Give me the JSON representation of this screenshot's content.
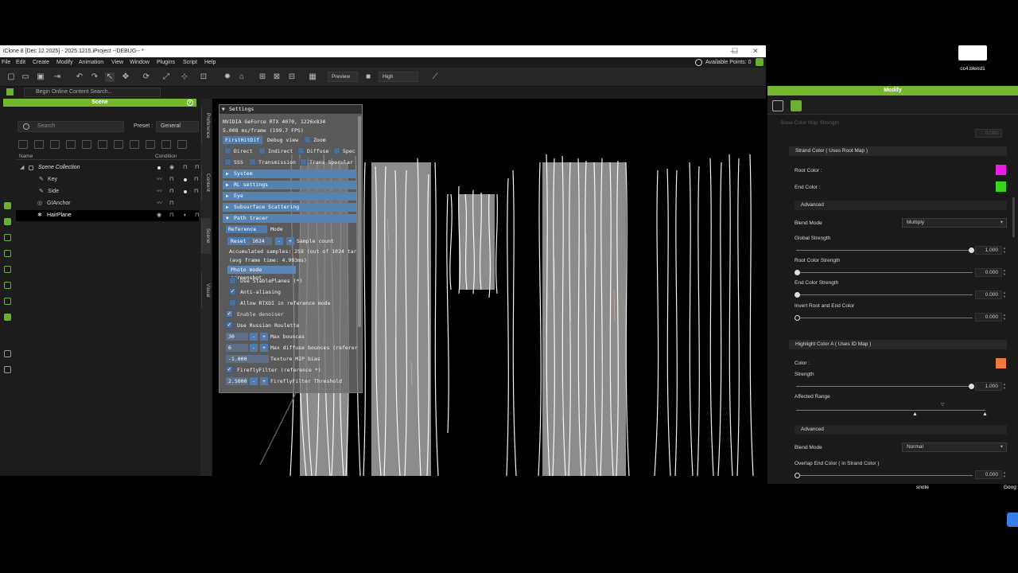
{
  "window": {
    "title": "iClone 8 [Dec 12 2025] - 2025.1215.iProject --DEBUG-- *",
    "controls": [
      "—",
      "☐",
      "✕"
    ]
  },
  "menu": {
    "items": [
      "File",
      "Edit",
      "Create",
      "Modify",
      "Animation",
      "View",
      "Window",
      "Plugins",
      "Script",
      "Help"
    ],
    "points": "Available Points: 0"
  },
  "toolbar": {
    "preview_label": "Preview",
    "quality_label": "High"
  },
  "search": {
    "online_placeholder": "Begin Online Content Search..."
  },
  "scene": {
    "title": "Scene",
    "search_placeholder": "Search",
    "preset_label": "Preset :",
    "preset_value": "General",
    "col_name": "Name",
    "col_condition": "Condition",
    "items": [
      {
        "label": "Scene Collection",
        "indent": 0
      },
      {
        "label": "Key",
        "indent": 2
      },
      {
        "label": "Side",
        "indent": 2
      },
      {
        "label": "GIAnchor",
        "indent": 2
      },
      {
        "label": "HairPlane",
        "indent": 2
      }
    ],
    "side_tabs": [
      "Preference",
      "Content",
      "Scene",
      "Visual"
    ]
  },
  "settings": {
    "title": "Settings",
    "gpu_line": "NVIDIA GeForce RTX 4070, 1226x834",
    "fps_line": "5.008 ms/frame (199.7 FPS)",
    "debug_select": "FirstHitDif",
    "debug_view": "Debug view",
    "zoom": "Zoom",
    "checks_row1": [
      "Direct",
      "Indirect",
      "Diffuse",
      "Spec"
    ],
    "checks_row2": [
      "SSS",
      "Transmission",
      "Trans Specular"
    ],
    "sections": [
      "System",
      "RL settings",
      "Eye",
      "Subsurface Scattering",
      "Path tracer"
    ],
    "mode_select": "Reference",
    "mode_label": "Mode",
    "reset": "Reset",
    "sample_value": "1024",
    "minus": "-",
    "plus": "+",
    "sample_label": "Sample count",
    "accum_line": "Accumulated samples: 258 (out of 1024 tar",
    "avg_line": "(avg frame time: 4.993ms)",
    "photo_btn": "Photo mode screenshot",
    "opt_stable": "Use StablePlanes (*)",
    "opt_aa": "Anti-aliasing",
    "opt_rtxdi": "Allow RTXDI in reference mode",
    "opt_denoiser": "Enable denoiser",
    "opt_roulette": "Use Russian Roulette",
    "max_bounces_val": "30",
    "max_bounces": "Max bounces",
    "max_diffuse_val": "6",
    "max_diffuse": "Max diffuse bounces (referer",
    "mip_val": "-1.000",
    "mip": "Texture MIP bias",
    "firefly": "FireflyFilter (reference *)",
    "firefly_thr_val": "2.5000",
    "firefly_thr": "FireflyFilter Threshold"
  },
  "modify": {
    "title": "Modify",
    "faded_label": "Base Color Map Strength",
    "faded_value": "0.000",
    "strand_section": "Strand Color ( Uses Root Map )",
    "root_color": "Root Color :",
    "end_color": "End Color :",
    "advanced": "Advanced",
    "blend_mode": "Blend Mode",
    "blend_value_1": "Multiply",
    "global_strength": "Global Strength",
    "global_strength_val": "1.000",
    "root_strength": "Root Color Strength",
    "root_strength_val": "0.000",
    "end_strength": "End Color Strength",
    "end_strength_val": "0.000",
    "invert": "Invert Root and End Color",
    "invert_val": "0.000",
    "highlight_section": "Highlight Color A ( Uses ID Map )",
    "color_label": "Color :",
    "strength": "Strength",
    "strength_val": "1.000",
    "affected_range": "Affected Range",
    "advanced2": "Advanced",
    "blend_mode2": "Blend Mode",
    "blend_value_2": "Normal",
    "overlap": "Overlap End Color ( in Strand Color )",
    "overlap_val": "0.000",
    "colors": {
      "root": "#e81ee6",
      "end": "#3ad61f",
      "highlight": "#f07a3c"
    }
  },
  "desktop": {
    "file_label": "cc4.blend1",
    "snote": "snote",
    "goog": "Goog"
  },
  "colors": {
    "accent": "#74b72e",
    "settings_blue": "#5583b3"
  }
}
